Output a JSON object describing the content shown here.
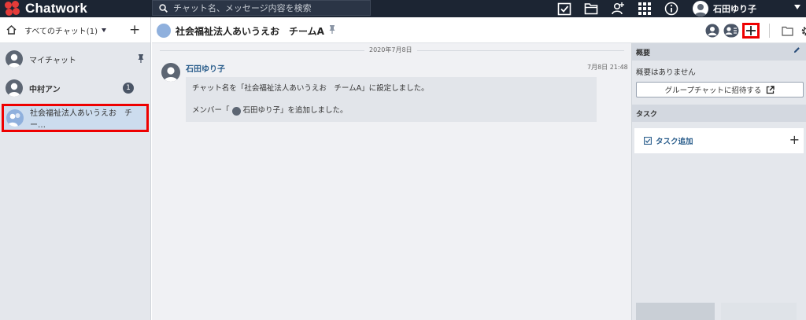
{
  "app": {
    "name": "Chatwork"
  },
  "colors": {
    "topbar": "#1c2533",
    "logo": "#e43b39",
    "highlight": "#ee0000",
    "accent_link": "#2b5e8c"
  },
  "search": {
    "placeholder": "チャット名、メッセージ内容を検索"
  },
  "top_icons": [
    "task-icon",
    "file-icon",
    "contact-add-icon",
    "apps-grid-icon",
    "help-icon"
  ],
  "user": {
    "name": "石田ゆり子"
  },
  "sidebar": {
    "filter_label": "すべてのチャット(1)",
    "rooms": [
      {
        "name": "マイチャット",
        "pinned": true
      },
      {
        "name": "中村アン",
        "unread": "1"
      },
      {
        "name": "社会福祉法人あいうえお　チー…",
        "selected": true
      }
    ]
  },
  "chat": {
    "room_title": "社会福祉法人あいうえお　チームA",
    "date": "2020年7月8日",
    "message": {
      "sender": "石田ゆり子",
      "time": "7月8日 21:48",
      "line1": "チャット名を「社会福祉法人あいうえお　チームA」に設定しました。",
      "line2_prefix": "メンバー「",
      "line2_member": "石田ゆり子",
      "line2_suffix": "」を追加しました。"
    }
  },
  "right_panel": {
    "overview_title": "概要",
    "overview_text": "概要はありません",
    "invite_button": "グループチャットに招待する",
    "task_title": "タスク",
    "task_add": "タスク追加"
  }
}
